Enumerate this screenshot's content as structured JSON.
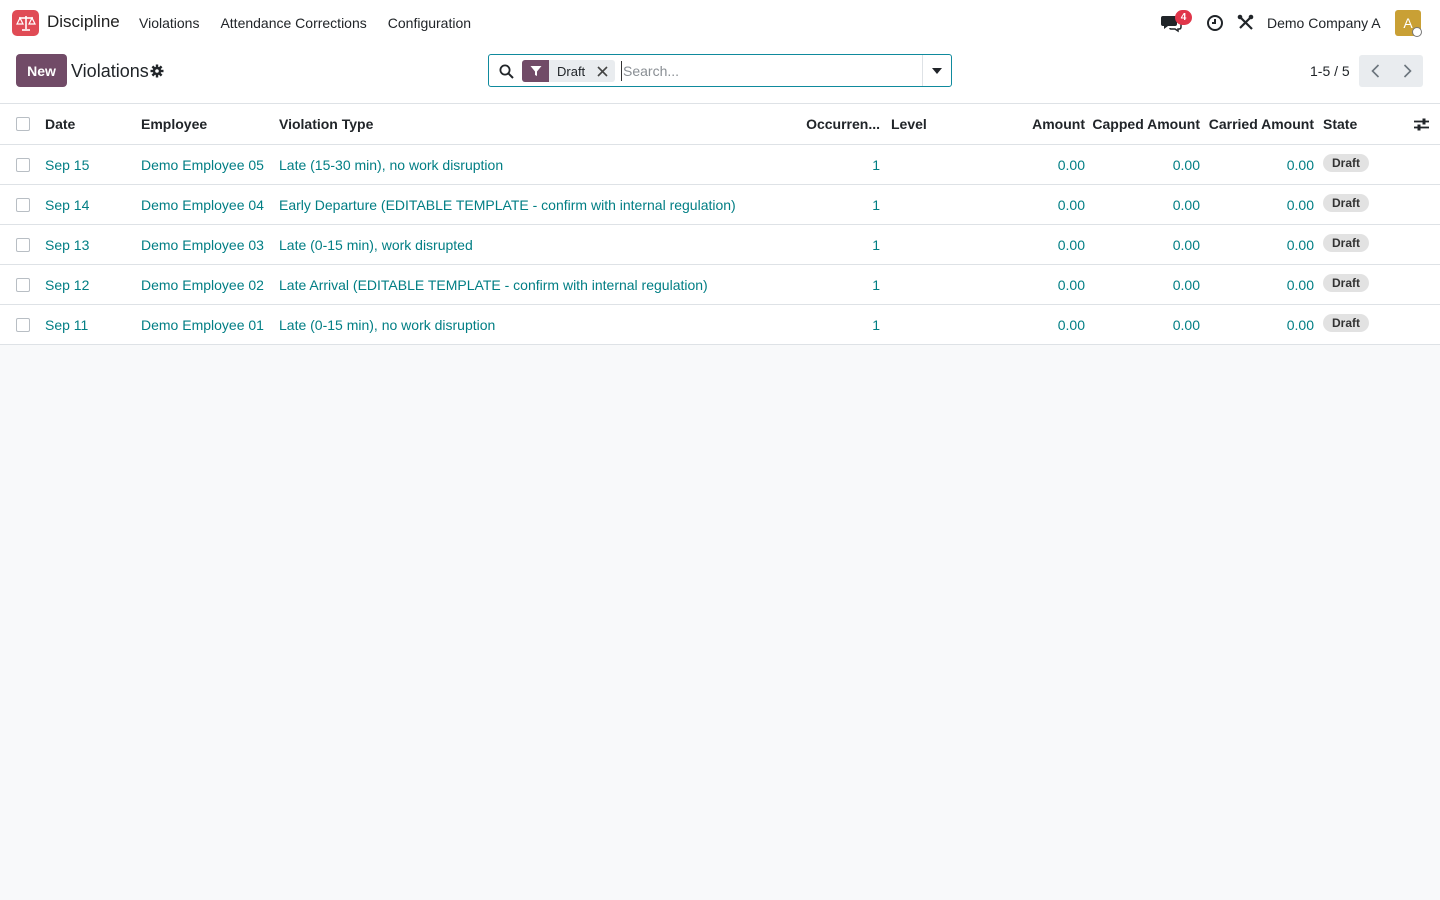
{
  "navbar": {
    "app_name": "Discipline",
    "menu": [
      "Violations",
      "Attendance Corrections",
      "Configuration"
    ],
    "chat_badge": "4",
    "company": "Demo Company A",
    "avatar_letter": "A",
    "app_icon_color": "#e04b55",
    "avatar_color": "#c9a035"
  },
  "control_panel": {
    "new_label": "New",
    "title": "Violations",
    "facet_value": "Draft",
    "search_placeholder": "Search...",
    "pager": "1-5 / 5",
    "accent_color": "#714b67"
  },
  "table": {
    "headers": {
      "date": "Date",
      "employee": "Employee",
      "violation_type": "Violation Type",
      "occurrences": "Occurren...",
      "level": "Level",
      "amount": "Amount",
      "capped_amount": "Capped Amount",
      "carried_amount": "Carried Amount",
      "state": "State"
    },
    "rows": [
      {
        "date": "Sep 15",
        "employee": "Demo Employee 05",
        "violation_type": "Late (15-30 min), no work disruption",
        "occurrences": "1",
        "level": "",
        "amount": "0.00",
        "capped_amount": "0.00",
        "carried_amount": "0.00",
        "state": "Draft"
      },
      {
        "date": "Sep 14",
        "employee": "Demo Employee 04",
        "violation_type": "Early Departure (EDITABLE TEMPLATE - confirm with internal regulation)",
        "occurrences": "1",
        "level": "",
        "amount": "0.00",
        "capped_amount": "0.00",
        "carried_amount": "0.00",
        "state": "Draft"
      },
      {
        "date": "Sep 13",
        "employee": "Demo Employee 03",
        "violation_type": "Late (0-15 min), work disrupted",
        "occurrences": "1",
        "level": "",
        "amount": "0.00",
        "capped_amount": "0.00",
        "carried_amount": "0.00",
        "state": "Draft"
      },
      {
        "date": "Sep 12",
        "employee": "Demo Employee 02",
        "violation_type": "Late Arrival (EDITABLE TEMPLATE - confirm with internal regulation)",
        "occurrences": "1",
        "level": "",
        "amount": "0.00",
        "capped_amount": "0.00",
        "carried_amount": "0.00",
        "state": "Draft"
      },
      {
        "date": "Sep 11",
        "employee": "Demo Employee 01",
        "violation_type": "Late (0-15 min), no work disruption",
        "occurrences": "1",
        "level": "",
        "amount": "0.00",
        "capped_amount": "0.00",
        "carried_amount": "0.00",
        "state": "Draft"
      }
    ],
    "link_color": "#017e84"
  }
}
